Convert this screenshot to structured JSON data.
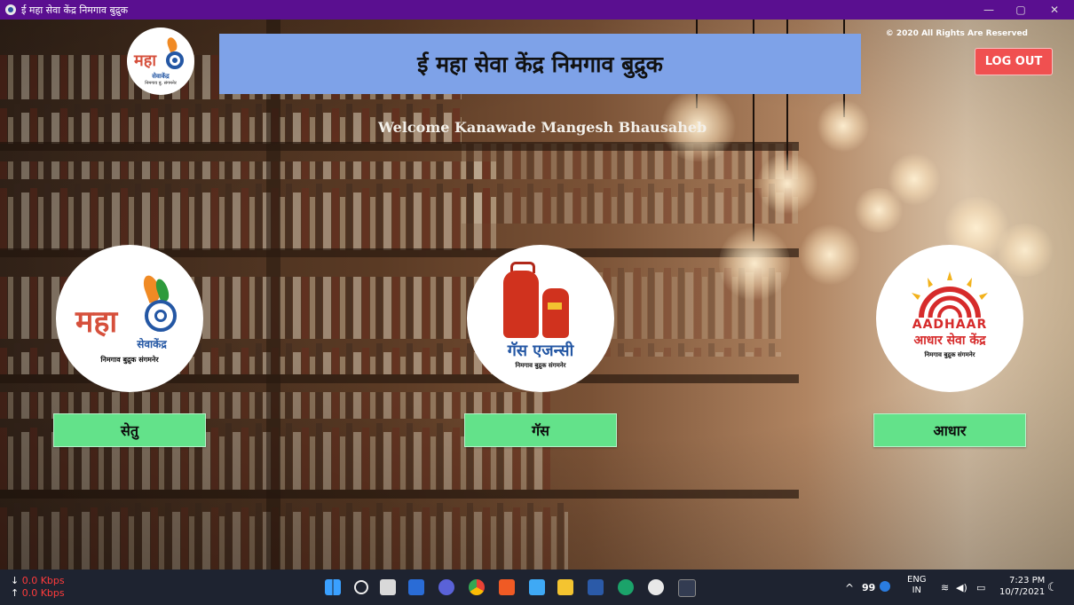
{
  "window": {
    "title": "ई महा सेवा केंद्र निमगाव बुद्रुक",
    "minimize_icon": "—",
    "restore_icon": "▢",
    "close_icon": "✕"
  },
  "header": {
    "banner_title": "ई महा सेवा केंद्र निमगाव बुद्रुक",
    "copyright": "© 2020 All Rights Are Reserved",
    "logout_label": "LOG OUT",
    "welcome": "Welcome Kanawade Mangesh Bhausaheb",
    "small_logo": {
      "word": "महा",
      "sub": "सेवाकेंद्र",
      "place": "निमगाव बु. संगमनेर"
    }
  },
  "services": [
    {
      "id": "setu",
      "logo_word": "महा",
      "logo_sub": "सेवाकेंद्र",
      "logo_place": "निमगाव बुद्रुक संगमनेर",
      "button": "सेतु"
    },
    {
      "id": "gas",
      "logo_word": "गॅस एजन्सी",
      "logo_place": "निमगाव बुद्रुक संगमनेर",
      "button": "गॅस"
    },
    {
      "id": "aadhaar",
      "logo_word": "AADHAAR",
      "logo_sub": "आधार सेवा केंद्र",
      "logo_place": "निमगाव बुद्रुक संगमनेर",
      "button": "आधार"
    }
  ],
  "taskbar": {
    "download_speed": "0.0 Kbps",
    "upload_speed": "0.0 Kbps",
    "down_arrow": "↓",
    "up_arrow": "↑",
    "tray_chevron": "^",
    "battery_level": "99",
    "lang": "ENG",
    "region": "IN",
    "time": "7:23 PM",
    "date": "10/7/2021"
  },
  "colors": {
    "titlebar": "#5a0f90",
    "banner": "#7ea2e8",
    "logout": "#f05050",
    "service_button": "#63e28a"
  }
}
